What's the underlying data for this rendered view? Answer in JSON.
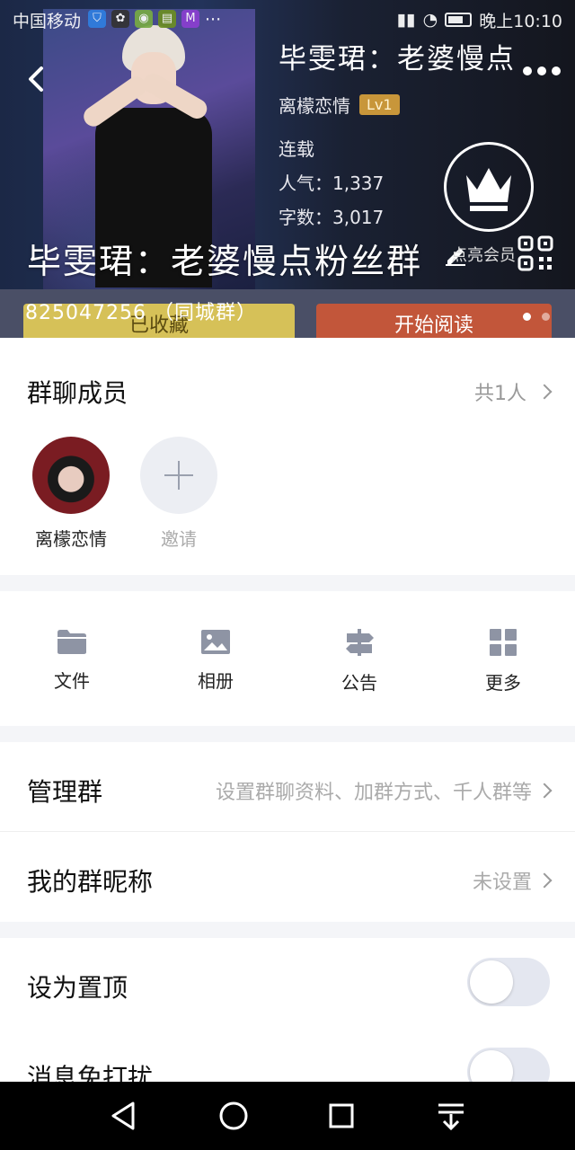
{
  "status_bar": {
    "carrier": "中国移动",
    "time": "晚上10:10",
    "notification_icons": [
      "shield-icon",
      "paw-icon",
      "chat-icon",
      "app-icon",
      "m-app-icon"
    ],
    "more_notifications": "···"
  },
  "banner": {
    "book_title": "毕雯珺：老婆慢点",
    "author": "离檬恋情",
    "author_level": "Lv1",
    "serial_status": "连载",
    "popularity": "人气：1,337",
    "word_count": "字数：3,017",
    "group_name": "毕雯珺：老婆慢点粉丝群",
    "group_number": "825047256 （同城群）",
    "vip_hint": "点亮会员",
    "favorite_button": "已收藏",
    "read_button": "开始阅读",
    "page_count": 2,
    "active_page": 0
  },
  "members_section": {
    "title": "群聊成员",
    "count": "共1人",
    "members": [
      {
        "name": "离檬恋情"
      }
    ],
    "invite_label": "邀请"
  },
  "tools": [
    {
      "label": "文件",
      "icon": "folder-icon"
    },
    {
      "label": "相册",
      "icon": "image-icon"
    },
    {
      "label": "公告",
      "icon": "signpost-icon"
    },
    {
      "label": "更多",
      "icon": "grid-icon"
    }
  ],
  "settings": {
    "manage": {
      "title": "管理群",
      "hint": "设置群聊资料、加群方式、千人群等"
    },
    "nickname": {
      "title": "我的群昵称",
      "hint": "未设置"
    },
    "pin_top": {
      "title": "设为置顶",
      "on": false
    },
    "do_not_disturb": {
      "title": "消息免打扰",
      "on": false
    }
  },
  "colors": {
    "accent_gold": "#c8963a",
    "favorite_button": "#d6c158",
    "read_button": "#c2563a",
    "icon_gray": "#8e94a4"
  }
}
